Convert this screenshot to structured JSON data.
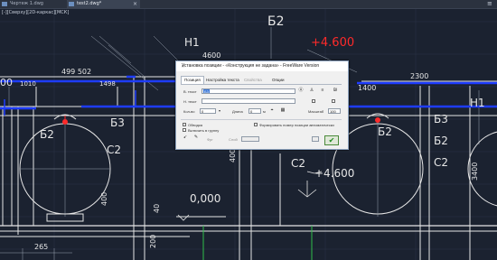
{
  "tabs": [
    {
      "label": "Чертеж 1.dwg",
      "active": false
    },
    {
      "label": "test2.dwg*",
      "active": true
    }
  ],
  "view_controls": "[-][Сверху][2D-каркас][МСК]",
  "drawing": {
    "texts_white": [
      "Б2",
      "Н1",
      "4600",
      "499 502",
      "1010",
      "1498",
      "00",
      "Б2",
      "С2",
      "Б3",
      "С2",
      "Б2",
      "Б3",
      "Б2",
      "С2",
      "2300",
      "1400",
      "Н1",
      "400",
      "3400",
      "0,000",
      "265",
      "200",
      "40",
      "+4.600",
      "400"
    ],
    "elevation_red": "+4.600",
    "elevation_white": "+4.600",
    "zero_mark": "0,000"
  },
  "dialog": {
    "title": "Установка позиции - «Конструкция не задана» - FreeWare Version",
    "tabs": [
      "Позиция",
      "Настройка текста",
      "Свойства",
      "Опции"
    ],
    "upper_text_label": "В. текст",
    "upper_text_value": "Б3",
    "lower_text_label": "Н. текст",
    "lower_text_value": "",
    "count_label": "Кол-во",
    "count_value": "0",
    "length_label": "Длина",
    "length_value": "0",
    "length_unit": "м",
    "scale_label": "Масштаб",
    "scale_value": "100",
    "checkbox_framed": "Обводка",
    "checkbox_group": "Включить в группу",
    "checkbox_auto": "Формировать номер позиции автоматически",
    "layer_label": "Слой",
    "bind_label": "Фрг",
    "ok_icon": "checkmark-icon"
  },
  "colors": {
    "background": "#1b2230",
    "elevation_red": "#ff2a2a",
    "beam_blue": "#1e3cff",
    "line_white": "#e6e6e6",
    "dialog_bg": "#f0f0f0"
  }
}
